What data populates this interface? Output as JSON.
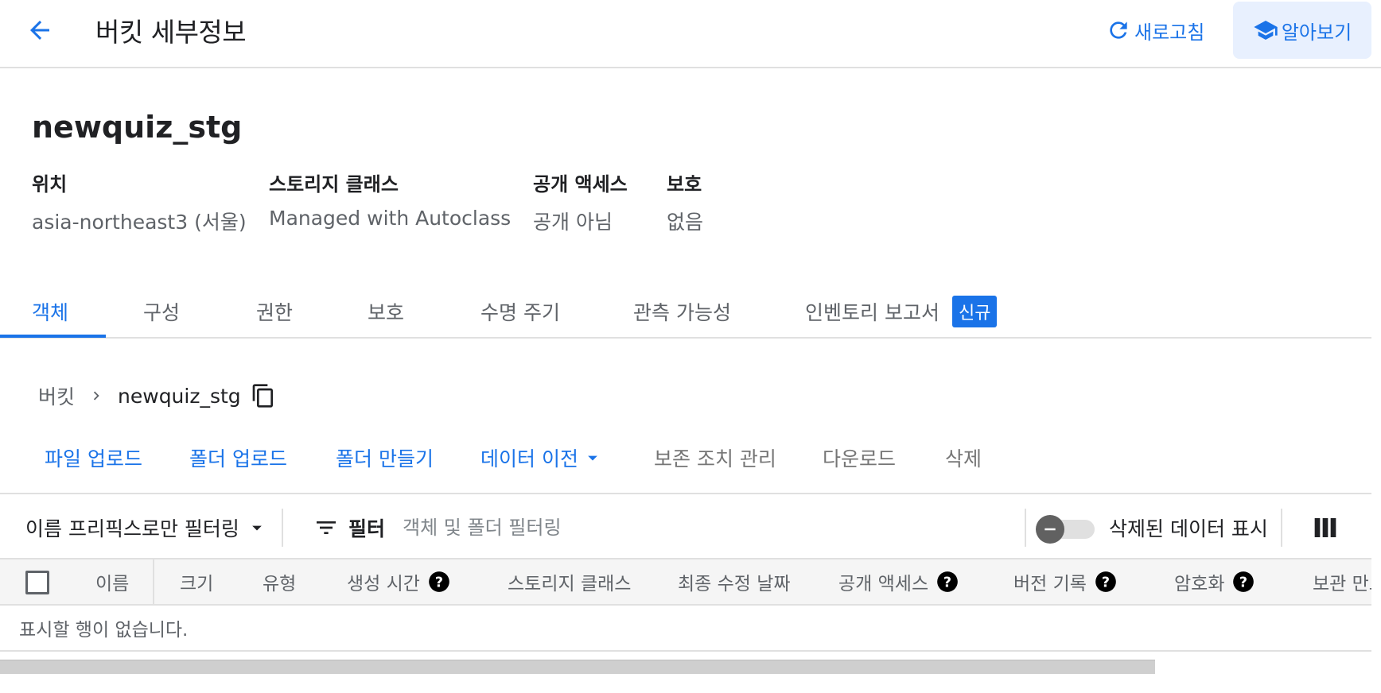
{
  "header": {
    "title": "버킷 세부정보",
    "refresh_label": "새로고침",
    "learn_label": "알아보기"
  },
  "bucket": {
    "name": "newquiz_stg",
    "info": [
      {
        "label": "위치",
        "value": "asia-northeast3 (서울)"
      },
      {
        "label": "스토리지 클래스",
        "value": "Managed with Autoclass"
      },
      {
        "label": "공개 액세스",
        "value": "공개 아님"
      },
      {
        "label": "보호",
        "value": "없음"
      }
    ]
  },
  "tabs": [
    {
      "label": "객체",
      "active": true
    },
    {
      "label": "구성"
    },
    {
      "label": "권한"
    },
    {
      "label": "보호"
    },
    {
      "label": "수명 주기"
    },
    {
      "label": "관측 가능성"
    },
    {
      "label": "인벤토리 보고서",
      "badge": "신규"
    }
  ],
  "breadcrumb": {
    "root": "버킷",
    "current": "newquiz_stg"
  },
  "actions": [
    {
      "label": "파일 업로드",
      "style": "primary"
    },
    {
      "label": "폴더 업로드",
      "style": "primary"
    },
    {
      "label": "폴더 만들기",
      "style": "primary"
    },
    {
      "label": "데이터 이전",
      "style": "primary",
      "dropdown": true
    },
    {
      "label": "보존 조치 관리",
      "style": "disabled"
    },
    {
      "label": "다운로드",
      "style": "disabled"
    },
    {
      "label": "삭제",
      "style": "disabled"
    }
  ],
  "filterbar": {
    "prefix_select": "이름 프리픽스로만 필터링",
    "filter_label": "필터",
    "filter_placeholder": "객체 및 폴더 필터링",
    "show_deleted_label": "삭제된 데이터 표시",
    "show_deleted_on": false
  },
  "table": {
    "columns": [
      {
        "label": "이름"
      },
      {
        "label": "크기"
      },
      {
        "label": "유형"
      },
      {
        "label": "생성 시간",
        "help": true
      },
      {
        "label": "스토리지 클래스"
      },
      {
        "label": "최종 수정 날짜"
      },
      {
        "label": "공개 액세스",
        "help": true
      },
      {
        "label": "버전 기록",
        "help": true
      },
      {
        "label": "암호화",
        "help": true
      },
      {
        "label": "보관 만료"
      }
    ],
    "empty_message": "표시할 행이 없습니다."
  },
  "colors": {
    "accent": "#1a73e8",
    "badge_bg": "#1a73e8",
    "learn_bg": "#e8f0fe"
  }
}
